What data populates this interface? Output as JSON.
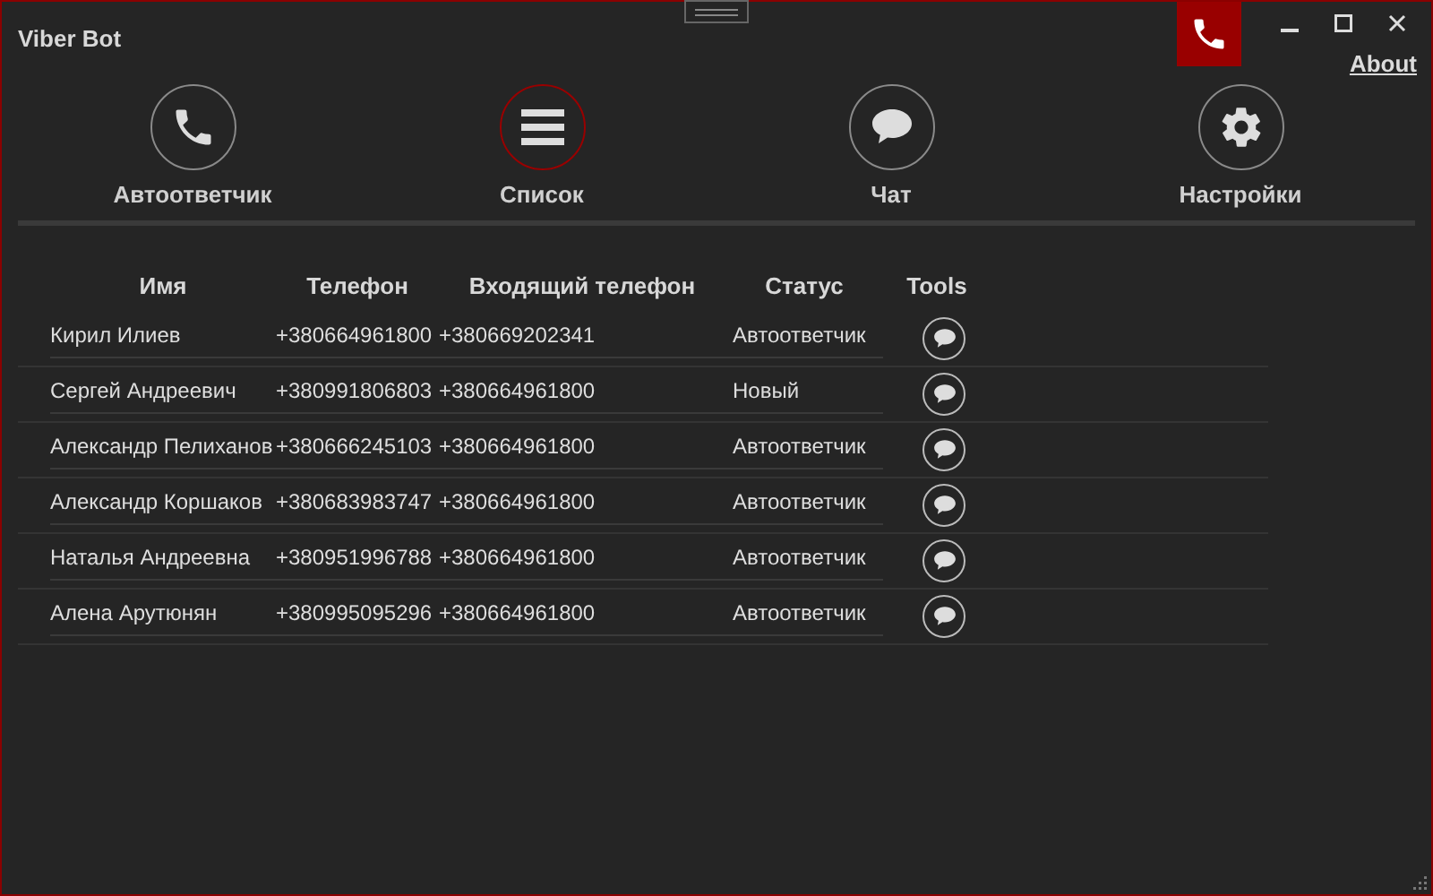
{
  "window": {
    "title": "Viber Bot"
  },
  "about_link": "About",
  "nav": [
    {
      "label": "Автоответчик",
      "kind": "phone",
      "selected": false
    },
    {
      "label": "Список",
      "kind": "list",
      "selected": true
    },
    {
      "label": "Чат",
      "kind": "chat",
      "selected": false
    },
    {
      "label": "Настройки",
      "kind": "settings",
      "selected": false
    }
  ],
  "table": {
    "columns": [
      "Имя",
      "Телефон",
      "Входящий телефон",
      "Статус",
      "Tools"
    ],
    "rows": [
      {
        "name": "Кирил Илиев",
        "phone": "+380664961800",
        "incoming": "+380669202341",
        "status": "Автоответчик"
      },
      {
        "name": "Сергей Андреевич",
        "phone": "+380991806803",
        "incoming": "+380664961800",
        "status": "Новый"
      },
      {
        "name": "Александр Пелиханов",
        "phone": "+380666245103",
        "incoming": "+380664961800",
        "status": "Автоответчик"
      },
      {
        "name": "Александр Коршаков",
        "phone": "+380683983747",
        "incoming": "+380664961800",
        "status": "Автоответчик"
      },
      {
        "name": "Наталья Андреевна",
        "phone": "+380951996788",
        "incoming": "+380664961800",
        "status": "Автоответчик"
      },
      {
        "name": "Алена Арутюнян",
        "phone": "+380995095296",
        "incoming": "+380664961800",
        "status": "Автоответчик"
      }
    ]
  }
}
